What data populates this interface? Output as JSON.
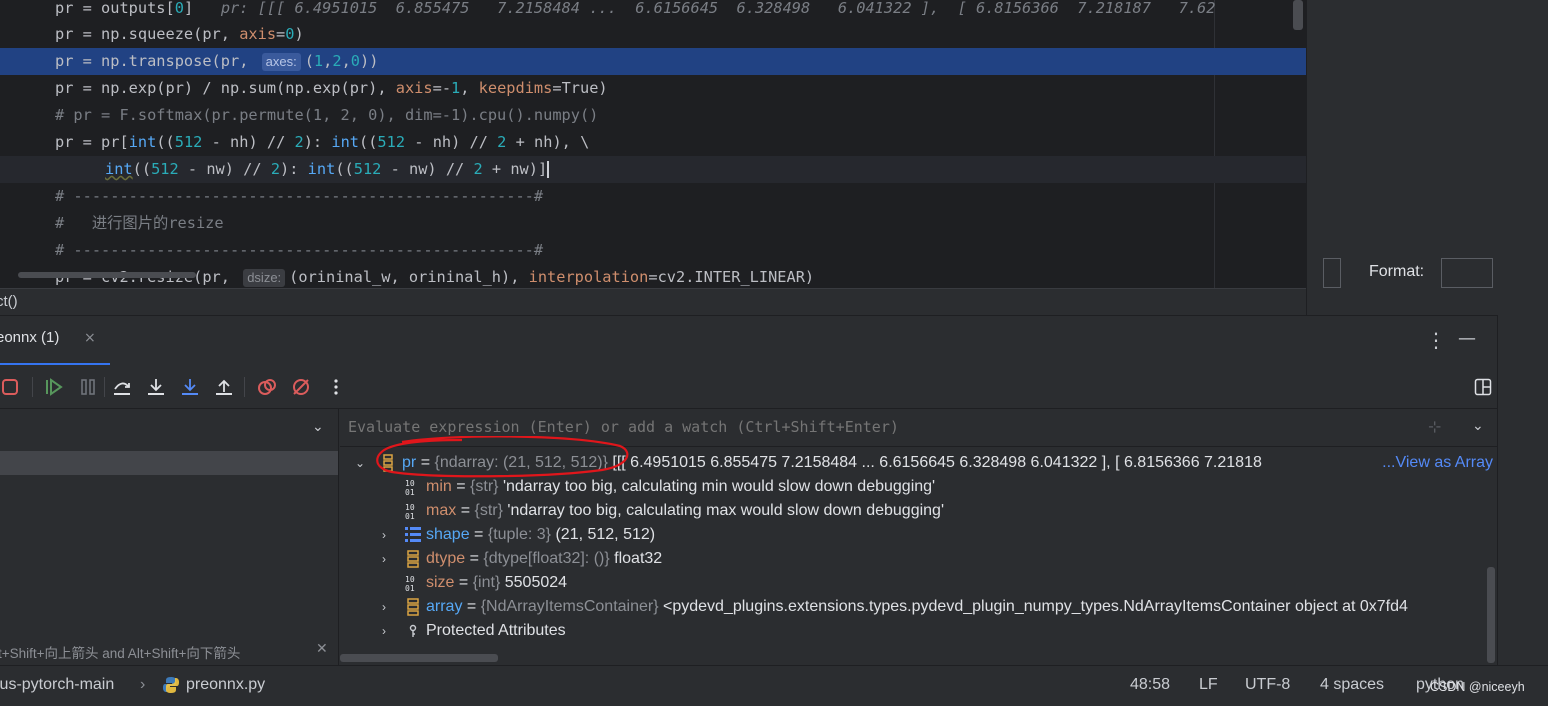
{
  "editor": {
    "line1": {
      "a": "pr = outputs[",
      "b": "0",
      "c": "]",
      "inline": "pr: [[[ 6.4951015  6.855475   7.2158484 ...  6.6156645  6.328498   6.041322 ],  [ 6.8156366  7.218187   7.62"
    },
    "line2": {
      "a": "pr = np.squeeze(pr, ",
      "kw": "axis",
      "eq": "=",
      "num": "0",
      "end": ")"
    },
    "line3": {
      "a": "pr = np.transpose(pr, ",
      "hint": "axes:",
      "b": "(",
      "n1": "1",
      "c1": ",",
      "n2": "2",
      "c2": ",",
      "n3": "0",
      "end": "))"
    },
    "line4": {
      "a": "pr = np.exp(pr) / np.sum(np.exp(pr), ",
      "kw1": "axis",
      "b": "=-",
      "n1": "1",
      "c": ", ",
      "kw2": "keepdims",
      "d": "=True)"
    },
    "line5": "# pr = F.softmax(pr.permute(1, 2, 0), dim=-1).cpu().numpy()",
    "line6": {
      "a": "pr = pr[",
      "fn": "int",
      "b": "((",
      "n1": "512",
      "c": " - nh) // ",
      "n2": "2",
      "d": "): ",
      "fn2": "int",
      "e": "((",
      "n3": "512",
      "f": " - nh) // ",
      "n4": "2",
      "g": " + nh), \\"
    },
    "line7": {
      "fn": "int",
      "b": "((",
      "n1": "512",
      "c": " - nw) // ",
      "n2": "2",
      "d": "): ",
      "fn2": "int",
      "e": "((",
      "n3": "512",
      "f": " - nw) // ",
      "n4": "2",
      "g": " + nw)]"
    },
    "line8": "# --------------------------------------------------#",
    "line9": "#   进行图片的resize",
    "line10": "# --------------------------------------------------#",
    "line11": {
      "a": "pr = cv2.resize(pr, ",
      "hint": "dsize:",
      "b": "(orininal_w, orininal_h), ",
      "kw": "interpolation",
      "c": "=cv2.INTER_LINEAR)"
    }
  },
  "right_pane": {
    "format_label": "Format:"
  },
  "breadcrumb": "ct()",
  "debug": {
    "tab_label": "eonnx (1)",
    "tab_close": "×",
    "frames_hint": "t+Shift+向上箭头 and Alt+Shift+向下箭头",
    "eval_placeholder": "Evaluate expression (Enter) or add a watch (Ctrl+Shift+Enter)"
  },
  "variables": [
    {
      "name": "pr",
      "type": "{ndarray: (21, 512, 512)}",
      "value": "[[[ 6.4951015  6.855475   7.2158484 ...  6.6156645  6.328498   6.041322 ],  [ 6.8156366  7.21818",
      "link": "...View as Array",
      "expanded": true
    },
    {
      "name": "min",
      "type": "{str}",
      "value": "'ndarray too big, calculating min would slow down debugging'"
    },
    {
      "name": "max",
      "type": "{str}",
      "value": "'ndarray too big, calculating max would slow down debugging'"
    },
    {
      "name": "shape",
      "type": "{tuple: 3}",
      "value": "(21, 512, 512)"
    },
    {
      "name": "dtype",
      "type": "{dtype[float32]: ()}",
      "value": "float32"
    },
    {
      "name": "size",
      "type": "{int}",
      "value": "5505024"
    },
    {
      "name": "array",
      "type": "{NdArrayItemsContainer}",
      "value": "<pydevd_plugins.extensions.types.pydevd_plugin_numpy_types.NdArrayItemsContainer object at 0x7fd4"
    },
    {
      "name": "Protected Attributes"
    }
  ],
  "statusbar": {
    "project": "lus-pytorch-main",
    "file": "preonnx.py",
    "position": "48:58",
    "line_sep": "LF",
    "encoding": "UTF-8",
    "indent": "4 spaces",
    "interpreter": "python",
    "watermark": "CSDN @niceeyh"
  },
  "colors": {
    "selection": "#214283",
    "accent": "#3574f0",
    "keyword": "#cf8e6d",
    "number": "#2aacb8",
    "link": "#548af7",
    "annotation_circle": "#e0161b"
  }
}
